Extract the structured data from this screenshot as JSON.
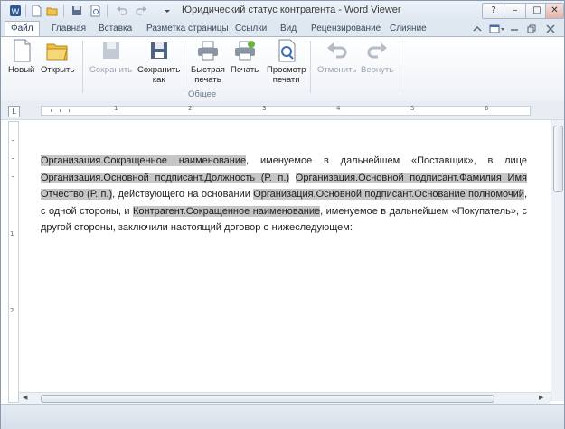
{
  "window": {
    "title": "Юридический статус контрагента - Word Viewer",
    "buttons": {
      "help": "?",
      "minimize": "–",
      "maximize": "□",
      "close": "✕"
    }
  },
  "quick_access": [
    "new-doc-icon",
    "open-folder-icon",
    "save-icon",
    "print-preview-icon",
    "undo-icon",
    "redo-icon",
    "customize-arrow-icon"
  ],
  "tabs": [
    "Файл",
    "Главная",
    "Вставка",
    "Разметка страницы",
    "Ссылки",
    "Вид",
    "Рецензирование",
    "Слияние"
  ],
  "ribbon": {
    "new": "Новый",
    "open": "Открыть",
    "save": "Сохранить",
    "save_as_1": "Сохранить",
    "save_as_2": "как",
    "quick_print_1": "Быстрая",
    "quick_print_2": "печать",
    "print": "Печать",
    "preview_1": "Просмотр",
    "preview_2": "печати",
    "undo": "Отменить",
    "redo": "Вернуть",
    "group_label": "Общее"
  },
  "ruler": {
    "corner": "L",
    "numbers": [
      "1",
      "2",
      "3",
      "4",
      "5",
      "6"
    ]
  },
  "vruler": {
    "numbers": [
      "1",
      "2"
    ]
  },
  "document": {
    "p1": "Организация.Сокращенное наименование",
    "p2": ", именуемое в дальнейшем «Поставщик», в лице ",
    "p3": "Организация.Основной подписант.Должность (Р. п.)",
    "p4": " ",
    "p5": "Организация.Основной подписант.Фамилия Имя Отчество (Р. п.)",
    "p6": ", действующего на основании ",
    "p7": "Организация.Основной подписант.Основание полномочий",
    "p8": ", с одной стороны, и ",
    "p9": "Контрагент.Сокращенное наименование",
    "p10": ", именуемое в дальнейшем «Покупатель», с другой стороны, заключили настоящий договор о нижеследующем:"
  },
  "colors": {
    "field_highlight": "#c6c6c6",
    "ribbon_bg": "#eef2f7",
    "title_bg": "#dfe7f1"
  }
}
